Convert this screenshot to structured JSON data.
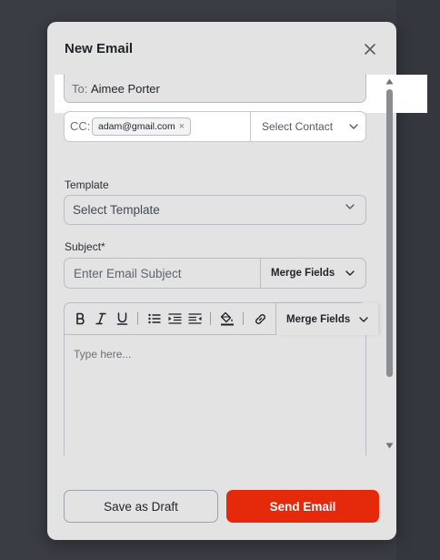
{
  "modal": {
    "title": "New Email",
    "close_icon": "close-icon"
  },
  "to": {
    "label": "To:",
    "value": "Aimee Porter"
  },
  "cc": {
    "label": "CC:",
    "chips": [
      "adam@gmail.com"
    ],
    "chip_remove": "×",
    "select_label": "Select Contact"
  },
  "template": {
    "label": "Template",
    "placeholder": "Select Template"
  },
  "subject": {
    "label": "Subject*",
    "placeholder": "Enter Email Subject",
    "merge_label": "Merge Fields"
  },
  "editor": {
    "toolbar_icons": [
      "bold-icon",
      "italic-icon",
      "underline-icon",
      "bullet-list-icon",
      "indent-icon",
      "outdent-icon",
      "fill-color-icon",
      "link-icon"
    ],
    "merge_label": "Merge Fields",
    "placeholder": "Type here..."
  },
  "footer": {
    "draft_label": "Save as Draft",
    "send_label": "Send Email"
  },
  "colors": {
    "accent": "#e52a0b",
    "modal_bg": "#e3e3e3",
    "backdrop": "#3a3d44"
  }
}
